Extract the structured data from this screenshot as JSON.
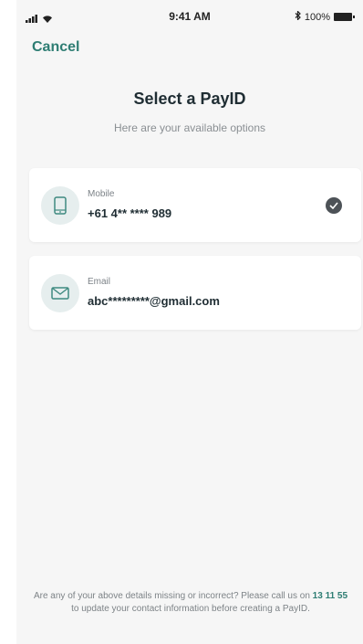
{
  "status_bar": {
    "time": "9:41 AM",
    "battery": "100%"
  },
  "header": {
    "cancel_label": "Cancel"
  },
  "main": {
    "title": "Select a PayID",
    "subtitle": "Here are your available options",
    "options": [
      {
        "type": "Mobile",
        "value": "+61 4** **** 989",
        "icon": "mobile-phone-icon",
        "selected": true
      },
      {
        "type": "Email",
        "value": "abc*********@gmail.com",
        "icon": "envelope-icon",
        "selected": false
      }
    ]
  },
  "footer": {
    "text_before": "Are any of your above details missing or incorrect? Please call us on",
    "phone": "13 11 55",
    "text_after": "to update your contact information before creating a PayID."
  },
  "colors": {
    "accent": "#2e7d73",
    "background": "#f6f6f6",
    "card": "#ffffff",
    "icon_circle": "#e6eeee",
    "check": "#4d5257"
  }
}
